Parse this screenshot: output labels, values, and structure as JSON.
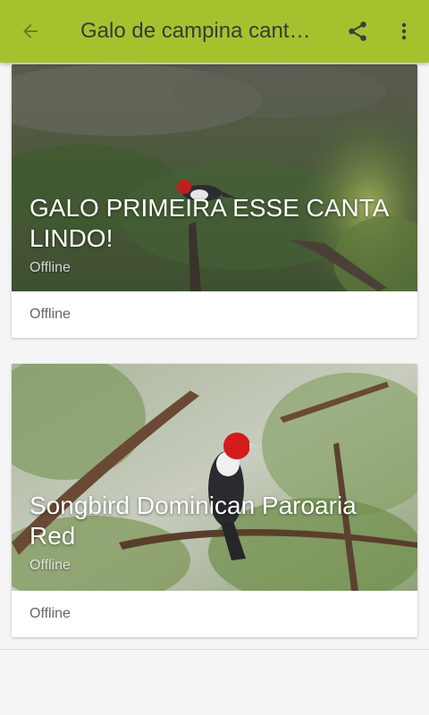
{
  "appbar": {
    "title": "Galo de campina cant…",
    "back_icon": "arrow-back-icon",
    "share_icon": "share-icon",
    "more_icon": "more-vert-icon",
    "color": "#a5c22e"
  },
  "cards": [
    {
      "title": "GALO PRIMEIRA ESSE CANTA LINDO!",
      "overlay_status": "Offline",
      "footer_status": "Offline"
    },
    {
      "title": "Songbird Dominican Paroaria Red",
      "overlay_status": "Offline",
      "footer_status": "Offline"
    }
  ]
}
